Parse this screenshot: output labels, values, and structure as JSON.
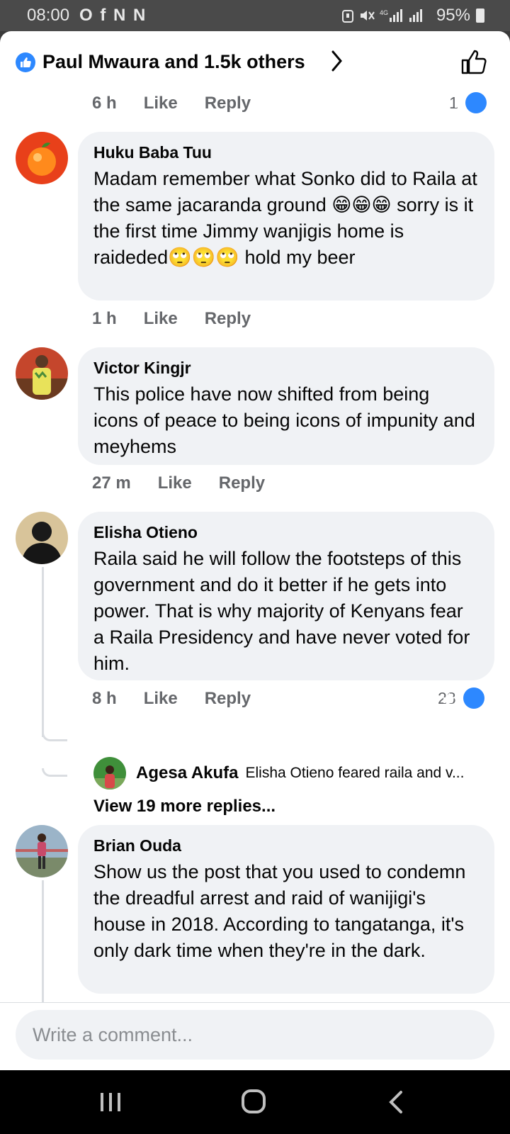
{
  "status_bar": {
    "time": "08:00",
    "notification_icons": "O f N N ",
    "battery": "95%"
  },
  "header": {
    "reactors": "Paul Mwaura and 1.5k others"
  },
  "comments": [
    {
      "time": "6 h",
      "like": "Like",
      "reply": "Reply",
      "reactions": "1"
    },
    {
      "name": "Huku Baba Tuu",
      "text": "Madam remember what Sonko did to Raila at the same jacaranda ground 😁😁😁 sorry is it the first time Jimmy wanjigis home is raideded🙄🙄🙄 hold my beer",
      "time": "1 h",
      "like": "Like",
      "reply": "Reply"
    },
    {
      "name": "Victor Kingjr",
      "text": "This police have now shifted from being icons of peace to being icons of impunity and meyhems",
      "time": "27 m",
      "like": "Like",
      "reply": "Reply"
    },
    {
      "name": "Elisha Otieno",
      "text": "Raila said he will follow the footsteps of this government and do it better if he gets into power.  That is why majority of Kenyans fear a Raila Presidency and have never voted for him.",
      "time": "8 h",
      "like": "Like",
      "reply": "Reply",
      "reactions": "28",
      "reply_preview": {
        "name": "Agesa Akufa",
        "text": "Elisha Otieno feared raila and v..."
      },
      "view_more": "View 19 more replies..."
    },
    {
      "name": "Brian Ouda",
      "text": "Show us the post that you used to condemn the dreadful arrest and raid of wanijigi's house in 2018. According to tangatanga, it's only dark time when they're in the dark."
    }
  ],
  "composer": {
    "placeholder": "Write a comment..."
  },
  "colors": {
    "accent": "#2d88ff",
    "bubble": "#f0f2f5",
    "meta": "#65676b"
  }
}
